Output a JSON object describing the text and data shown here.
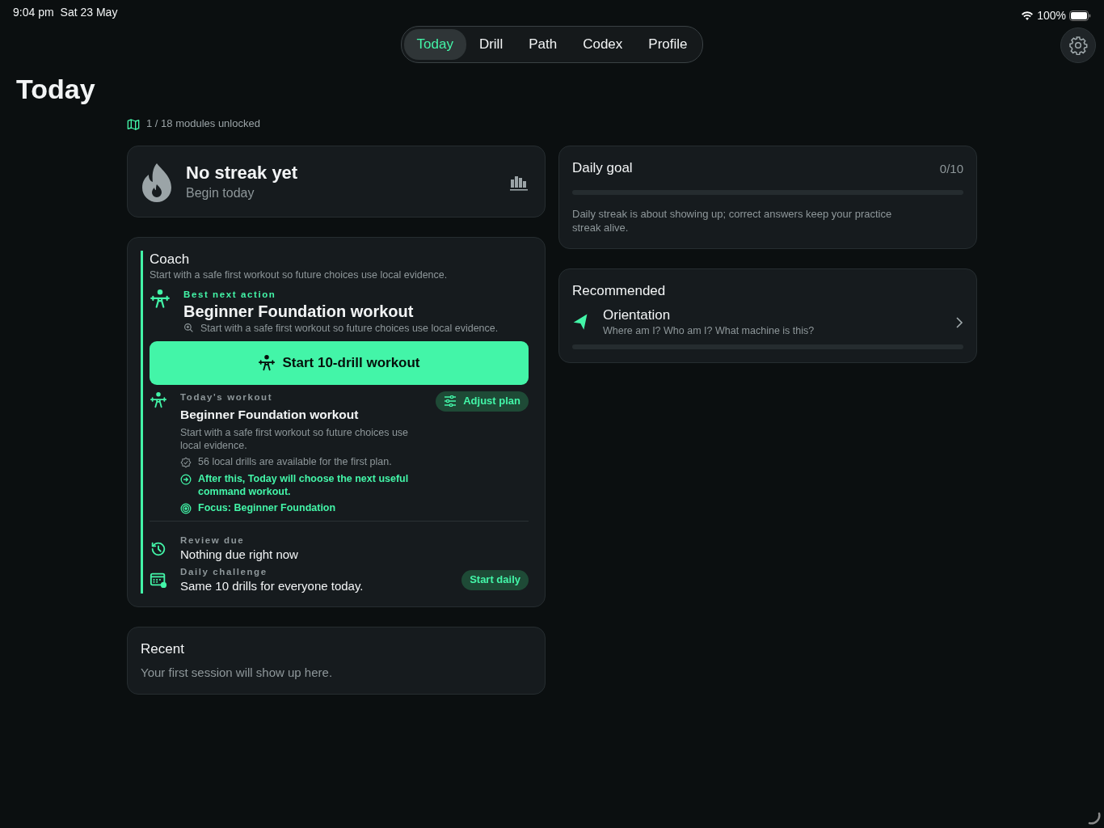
{
  "status_bar": {
    "time": "9:04 pm",
    "date": "Sat 23 May",
    "battery": "100%"
  },
  "tabs": [
    {
      "label": "Today",
      "selected": true
    },
    {
      "label": "Drill",
      "selected": false
    },
    {
      "label": "Path",
      "selected": false
    },
    {
      "label": "Codex",
      "selected": false
    },
    {
      "label": "Profile",
      "selected": false
    }
  ],
  "page_title": "Today",
  "modules": "1 / 18 modules unlocked",
  "streak": {
    "title": "No streak yet",
    "subtitle": "Begin today"
  },
  "coach": {
    "title": "Coach",
    "subtitle": "Start with a safe first workout so future choices use local evidence.",
    "best_next": {
      "label": "Best next action",
      "title": "Beginner Foundation workout",
      "detail": "Start with a safe first workout so future choices use local evidence."
    },
    "primary_button": "Start 10-drill workout",
    "todays_workout": {
      "label": "Today's workout",
      "title": "Beginner Foundation workout",
      "description": "Start with a safe first workout so future choices use local evidence.",
      "adjust_button": "Adjust plan",
      "notes": [
        {
          "kind": "check",
          "text": "56 local drills are available for the first plan.",
          "accent": false
        },
        {
          "kind": "arrow",
          "text": "After this, Today will choose the next useful command workout.",
          "accent": true
        },
        {
          "kind": "target",
          "text": "Focus: Beginner Foundation",
          "accent": true
        }
      ]
    },
    "review": {
      "label": "Review due",
      "text": "Nothing due right now"
    },
    "daily_challenge": {
      "label": "Daily challenge",
      "text": "Same 10 drills for everyone today.",
      "button": "Start daily"
    }
  },
  "recent": {
    "title": "Recent",
    "text": "Your first session will show up here."
  },
  "daily_goal": {
    "title": "Daily goal",
    "count": "0/10",
    "level": 0,
    "note": "Daily streak is about showing up; correct answers keep your practice streak alive."
  },
  "recommended": {
    "title": "Recommended",
    "items": [
      {
        "title": "Orientation",
        "subtitle": "Where am I? Who am I? What machine is this?",
        "level": 0
      }
    ]
  }
}
